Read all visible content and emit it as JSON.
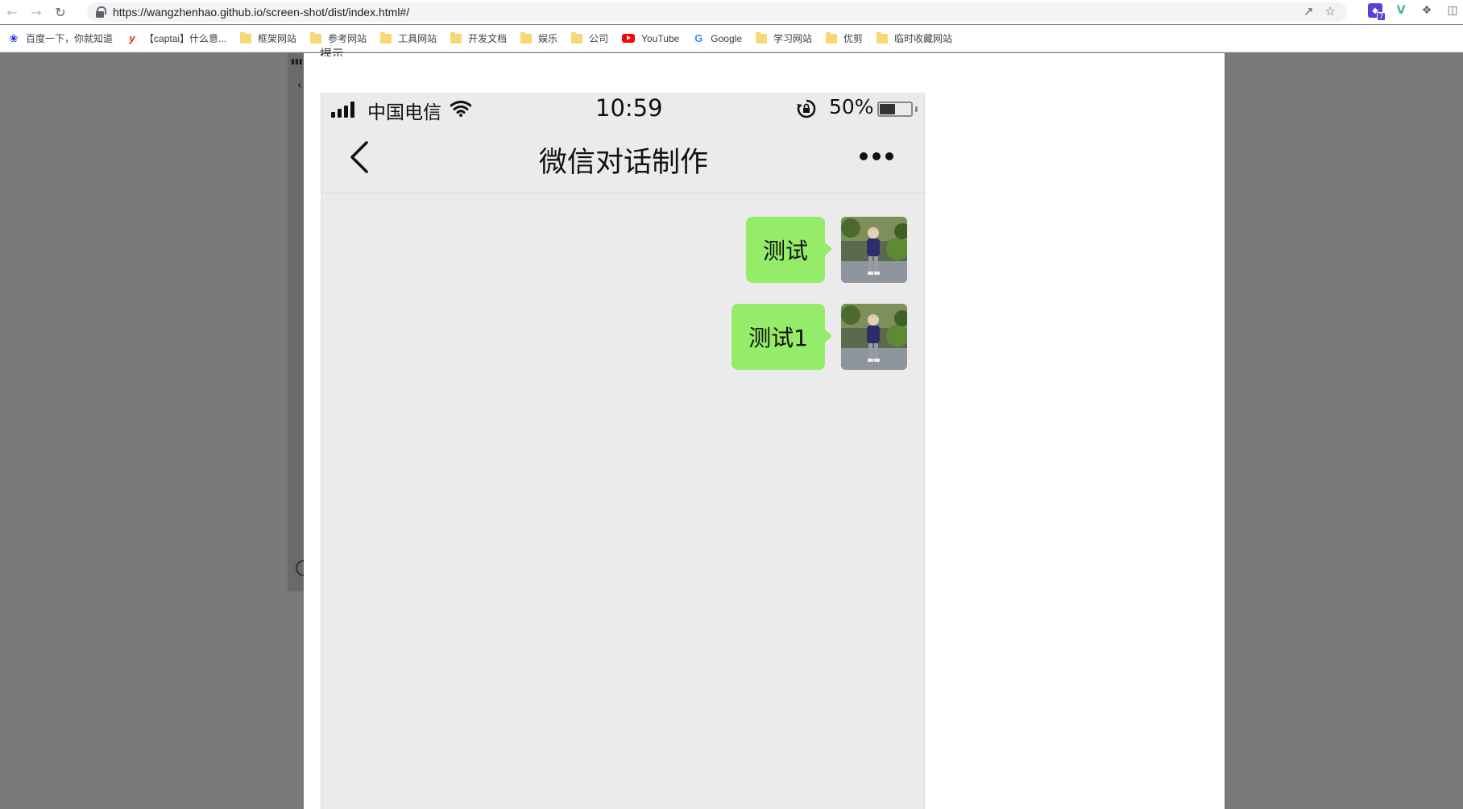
{
  "browser": {
    "url": "https://wangzhenhao.github.io/screen-shot/dist/index.html#/",
    "extension_badge": "7"
  },
  "bookmarks": [
    {
      "label": "百度一下，你就知道",
      "icon": "baidu-paw-icon"
    },
    {
      "label": "【captai】什么意...",
      "icon": "y-letter-icon"
    },
    {
      "label": "框架网站",
      "icon": "folder-icon"
    },
    {
      "label": "参考网站",
      "icon": "folder-icon"
    },
    {
      "label": "工具网站",
      "icon": "folder-icon"
    },
    {
      "label": "开发文档",
      "icon": "folder-icon"
    },
    {
      "label": "娱乐",
      "icon": "folder-icon"
    },
    {
      "label": "公司",
      "icon": "folder-icon"
    },
    {
      "label": "YouTube",
      "icon": "youtube-icon"
    },
    {
      "label": "Google",
      "icon": "google-icon"
    },
    {
      "label": "学习网站",
      "icon": "folder-icon"
    },
    {
      "label": "优剪",
      "icon": "folder-icon"
    },
    {
      "label": "临时收藏网站",
      "icon": "folder-icon"
    }
  ],
  "page": {
    "hint_label": "提示"
  },
  "phone": {
    "status": {
      "carrier": "中国电信",
      "time": "10:59",
      "battery_text": "50%",
      "battery_level": 0.5
    },
    "nav": {
      "title": "微信对话制作"
    },
    "messages": [
      {
        "text": "测试",
        "side": "right"
      },
      {
        "text": "测试1",
        "side": "right"
      }
    ]
  },
  "colors": {
    "bubble": "#95ec69",
    "chat_bg": "#ebebeb",
    "page_bg": "#7a7a7a"
  }
}
